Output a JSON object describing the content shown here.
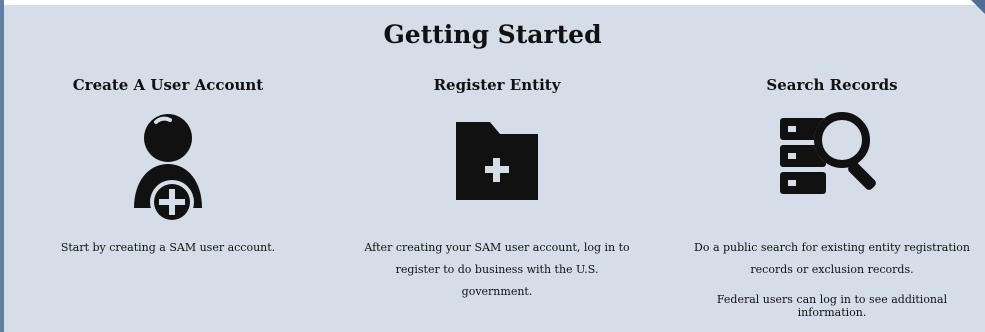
{
  "section": {
    "title": "Getting Started"
  },
  "columns": [
    {
      "heading": "Create A User Account",
      "icon": "add-user-icon",
      "description_lines": [
        "Start by creating a SAM user account."
      ]
    },
    {
      "heading": "Register Entity",
      "icon": "folder-plus-icon",
      "description_lines": [
        "After creating your SAM user account, log in to",
        "register to do business with the U.S. government."
      ]
    },
    {
      "heading": "Search Records",
      "icon": "search-records-icon",
      "description_lines": [
        "Do a public search for existing entity registration",
        "records or exclusion records."
      ],
      "extra_note": "Federal users can log in to see additional information."
    }
  ],
  "colors": {
    "background": "#d5dde8",
    "icon": "#111111",
    "edge": "#5f7fa3"
  }
}
